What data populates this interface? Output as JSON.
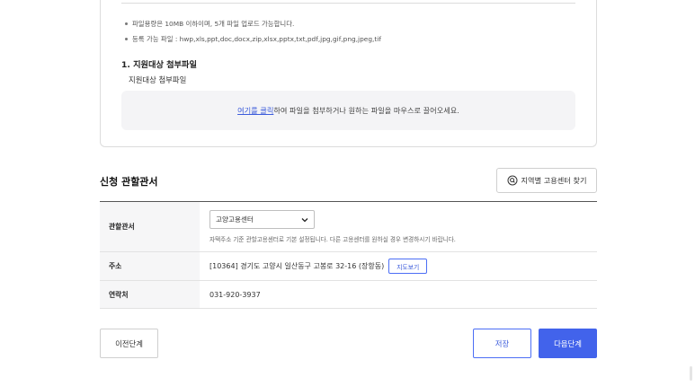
{
  "upload": {
    "notes": [
      "파일용량은 10MB 이하이며, 5개 파일 업로드 가능합니다.",
      "등록 가능 파일 : hwp,xls,ppt,doc,docx,zip,xlsx,pptx,txt,pdf,jpg,gif,png,jpeg,tif"
    ],
    "section_heading": "1. 지원대상 첨부파일",
    "sub_label": "지원대상 첨부파일",
    "dropzone_link": "여기를 클릭",
    "dropzone_text": "하여 파일을 첨부하거나 원하는 파일을 마우스로 끌어오세요."
  },
  "office": {
    "title": "신청 관할관서",
    "find_button": "지역별 고용센터 찾기",
    "rows": {
      "office_label": "관할관서",
      "office_selected": "고양고용센터",
      "office_help": "자택주소 기준 관할고용센터로 기본 설정됩니다. 다른 고용센터를 원하실 경우 변경하시기 바랍니다.",
      "address_label": "주소",
      "address_value": "[10364] 경기도 고양시 일산동구 고봉로 32-16 (장항동)",
      "map_button": "지도보기",
      "contact_label": "연락처",
      "contact_value": "031-920-3937"
    }
  },
  "actions": {
    "prev": "이전단계",
    "save": "저장",
    "next": "다음단계"
  },
  "colors": {
    "accent": "#4263eb",
    "link": "#3b5bdb"
  }
}
